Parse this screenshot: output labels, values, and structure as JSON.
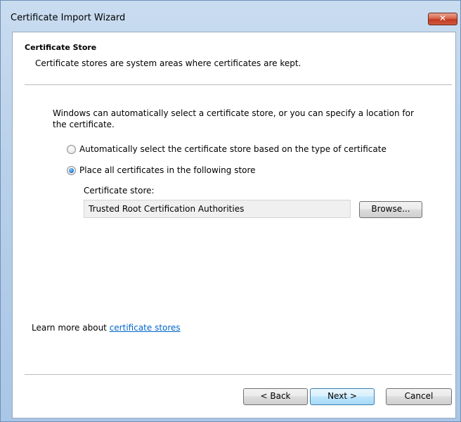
{
  "window": {
    "title": "Certificate Import Wizard",
    "close_glyph": "✕"
  },
  "header": {
    "title": "Certificate Store",
    "subtitle": "Certificate stores are system areas where certificates are kept."
  },
  "body": {
    "intro": "Windows can automatically select a certificate store, or you can specify a location for the certificate.",
    "options": [
      {
        "label": "Automatically select the certificate store based on the type of certificate",
        "checked": false
      },
      {
        "label": "Place all certificates in the following store",
        "checked": true
      }
    ],
    "store_label": "Certificate store:",
    "store_value": "Trusted Root Certification Authorities",
    "browse_label": "Browse..."
  },
  "footer": {
    "learn_prefix": "Learn more about ",
    "learn_link": "certificate stores",
    "back_label": "< Back",
    "next_label": "Next >",
    "cancel_label": "Cancel"
  },
  "colors": {
    "link": "#0066cc",
    "close_button": "#c13b22",
    "frame": "#b8d0ea"
  }
}
